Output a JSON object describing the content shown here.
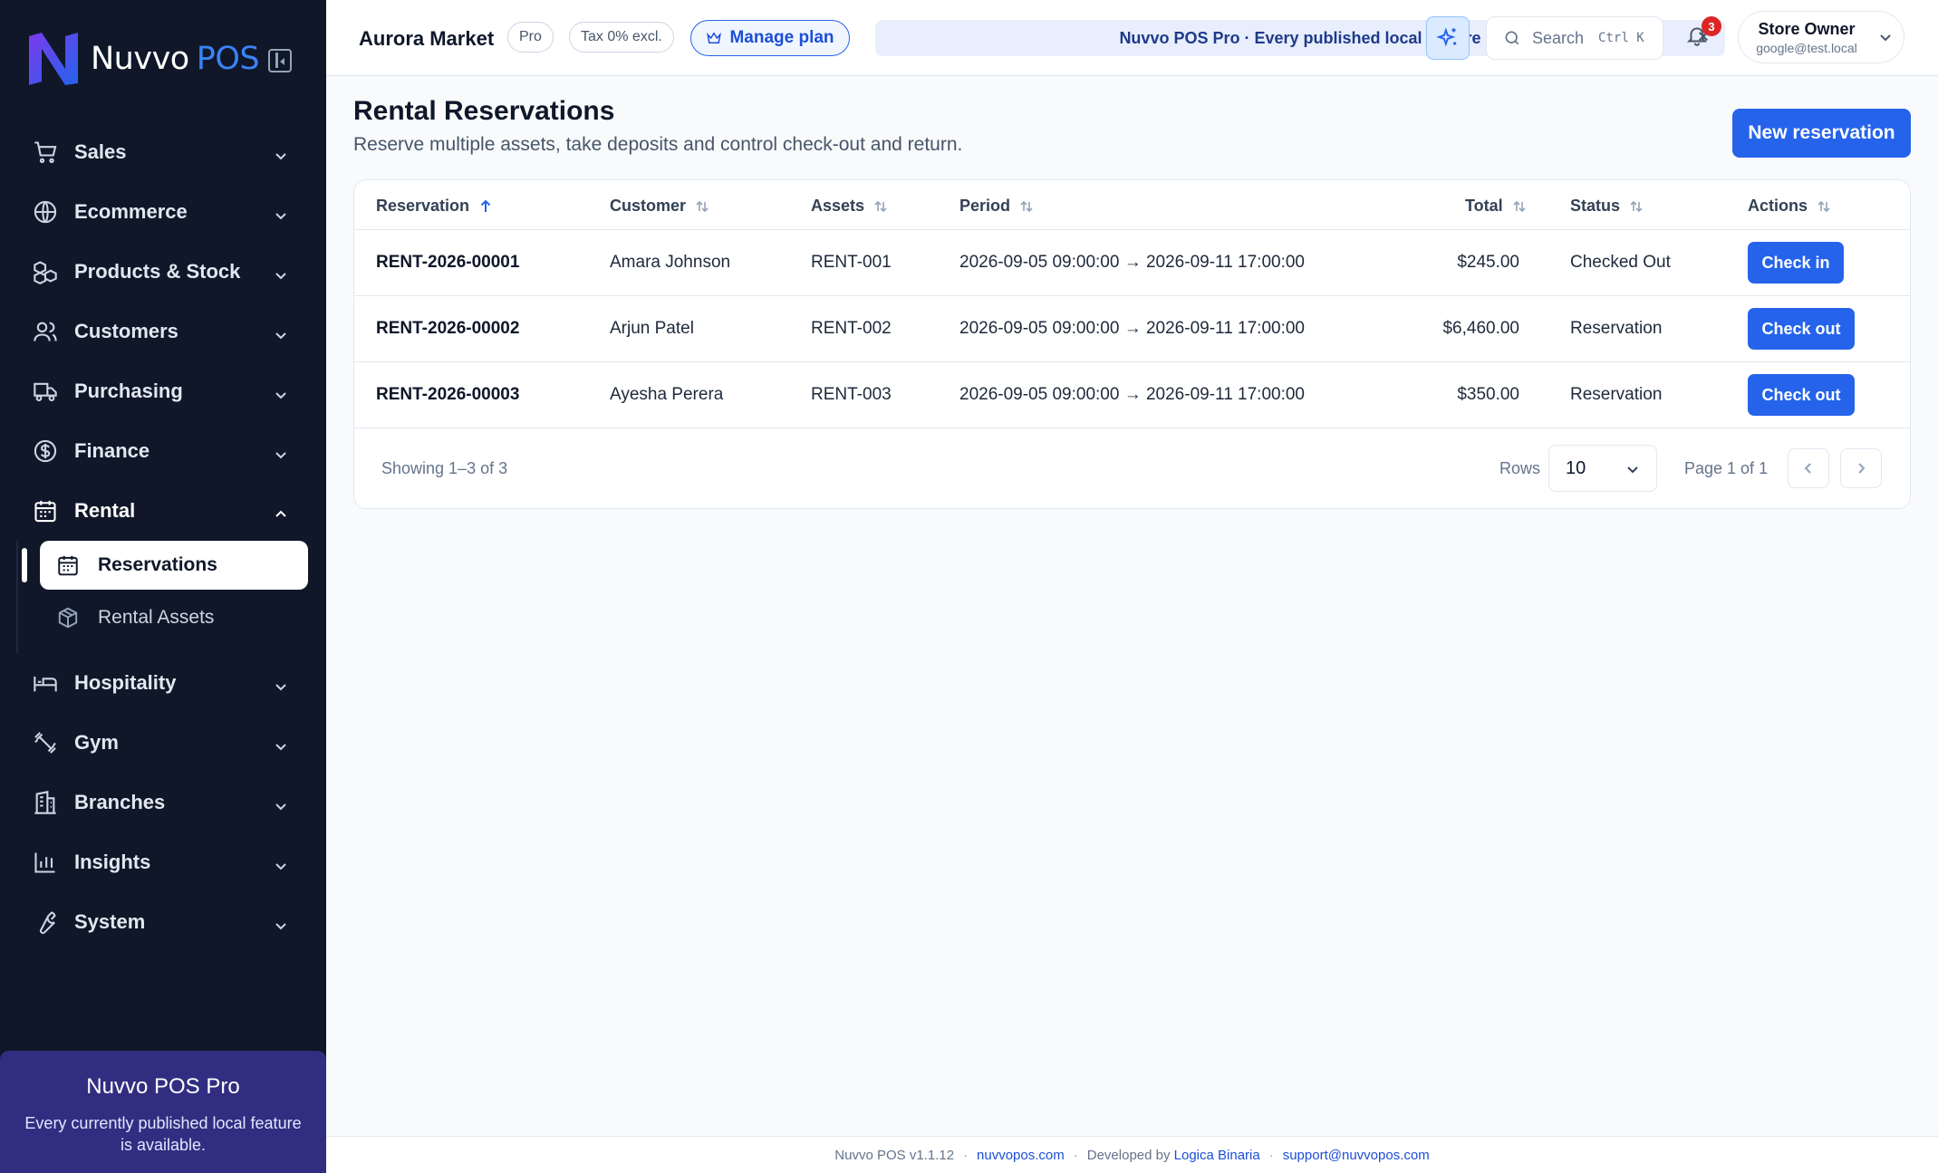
{
  "brand": {
    "name": "Nuvvo",
    "suffix": "POS"
  },
  "sidebar": {
    "items": [
      {
        "label": "Sales",
        "icon": "cart-icon"
      },
      {
        "label": "Ecommerce",
        "icon": "globe-icon"
      },
      {
        "label": "Products & Stock",
        "icon": "boxes-icon"
      },
      {
        "label": "Customers",
        "icon": "users-icon"
      },
      {
        "label": "Purchasing",
        "icon": "truck-icon"
      },
      {
        "label": "Finance",
        "icon": "dollar-icon"
      },
      {
        "label": "Rental",
        "icon": "calendar-icon",
        "open": true
      },
      {
        "label": "Hospitality",
        "icon": "bed-icon"
      },
      {
        "label": "Gym",
        "icon": "dumbbell-icon"
      },
      {
        "label": "Branches",
        "icon": "building-icon"
      },
      {
        "label": "Insights",
        "icon": "chart-icon"
      },
      {
        "label": "System",
        "icon": "wrench-icon"
      }
    ],
    "rental_sub": [
      {
        "label": "Reservations",
        "icon": "calendar-icon",
        "active": true
      },
      {
        "label": "Rental Assets",
        "icon": "package-icon"
      }
    ],
    "promo": {
      "title": "Nuvvo POS Pro",
      "text": "Every currently published local feature is available."
    }
  },
  "topbar": {
    "store_name": "Aurora Market",
    "plan_badge": "Pro",
    "tax_badge": "Tax 0% excl.",
    "manage_plan": "Manage plan",
    "banner": "Nuvvo POS Pro · Every published local feature",
    "search_placeholder": "Search",
    "search_shortcut": "Ctrl K",
    "notifications_count": "3",
    "user_name": "Store Owner",
    "user_email": "google@test.local"
  },
  "page": {
    "title": "Rental Reservations",
    "subtitle": "Reserve multiple assets, take deposits and control check-out and return.",
    "new_button": "New reservation"
  },
  "table": {
    "columns": [
      "Reservation",
      "Customer",
      "Assets",
      "Period",
      "Total",
      "Status",
      "Actions"
    ],
    "rows": [
      {
        "ref": "RENT-2026-00001",
        "customer": "Amara Johnson",
        "assets": "RENT-001",
        "period": "2026-09-05 09:00:00 → 2026-09-11 17:00:00",
        "total": "$245.00",
        "status": "Checked Out",
        "action": "Check in"
      },
      {
        "ref": "RENT-2026-00002",
        "customer": "Arjun Patel",
        "assets": "RENT-002",
        "period": "2026-09-05 09:00:00 → 2026-09-11 17:00:00",
        "total": "$6,460.00",
        "status": "Reservation",
        "action": "Check out"
      },
      {
        "ref": "RENT-2026-00003",
        "customer": "Ayesha Perera",
        "assets": "RENT-003",
        "period": "2026-09-05 09:00:00 → 2026-09-11 17:00:00",
        "total": "$350.00",
        "status": "Reservation",
        "action": "Check out"
      }
    ],
    "showing": "Showing 1–3 of 3",
    "rows_label": "Rows",
    "rows_value": "10",
    "page_info": "Page 1 of 1"
  },
  "footer": {
    "version": "Nuvvo POS v1.1.12",
    "site": "nuvvopos.com",
    "developed_by": "Developed by",
    "developer": "Logica Binaria",
    "email": "support@nuvvopos.com"
  },
  "colors": {
    "accent": "#2563eb",
    "sidebar": "#0f1729",
    "promo": "#312e81",
    "badge": "#dc2626"
  }
}
